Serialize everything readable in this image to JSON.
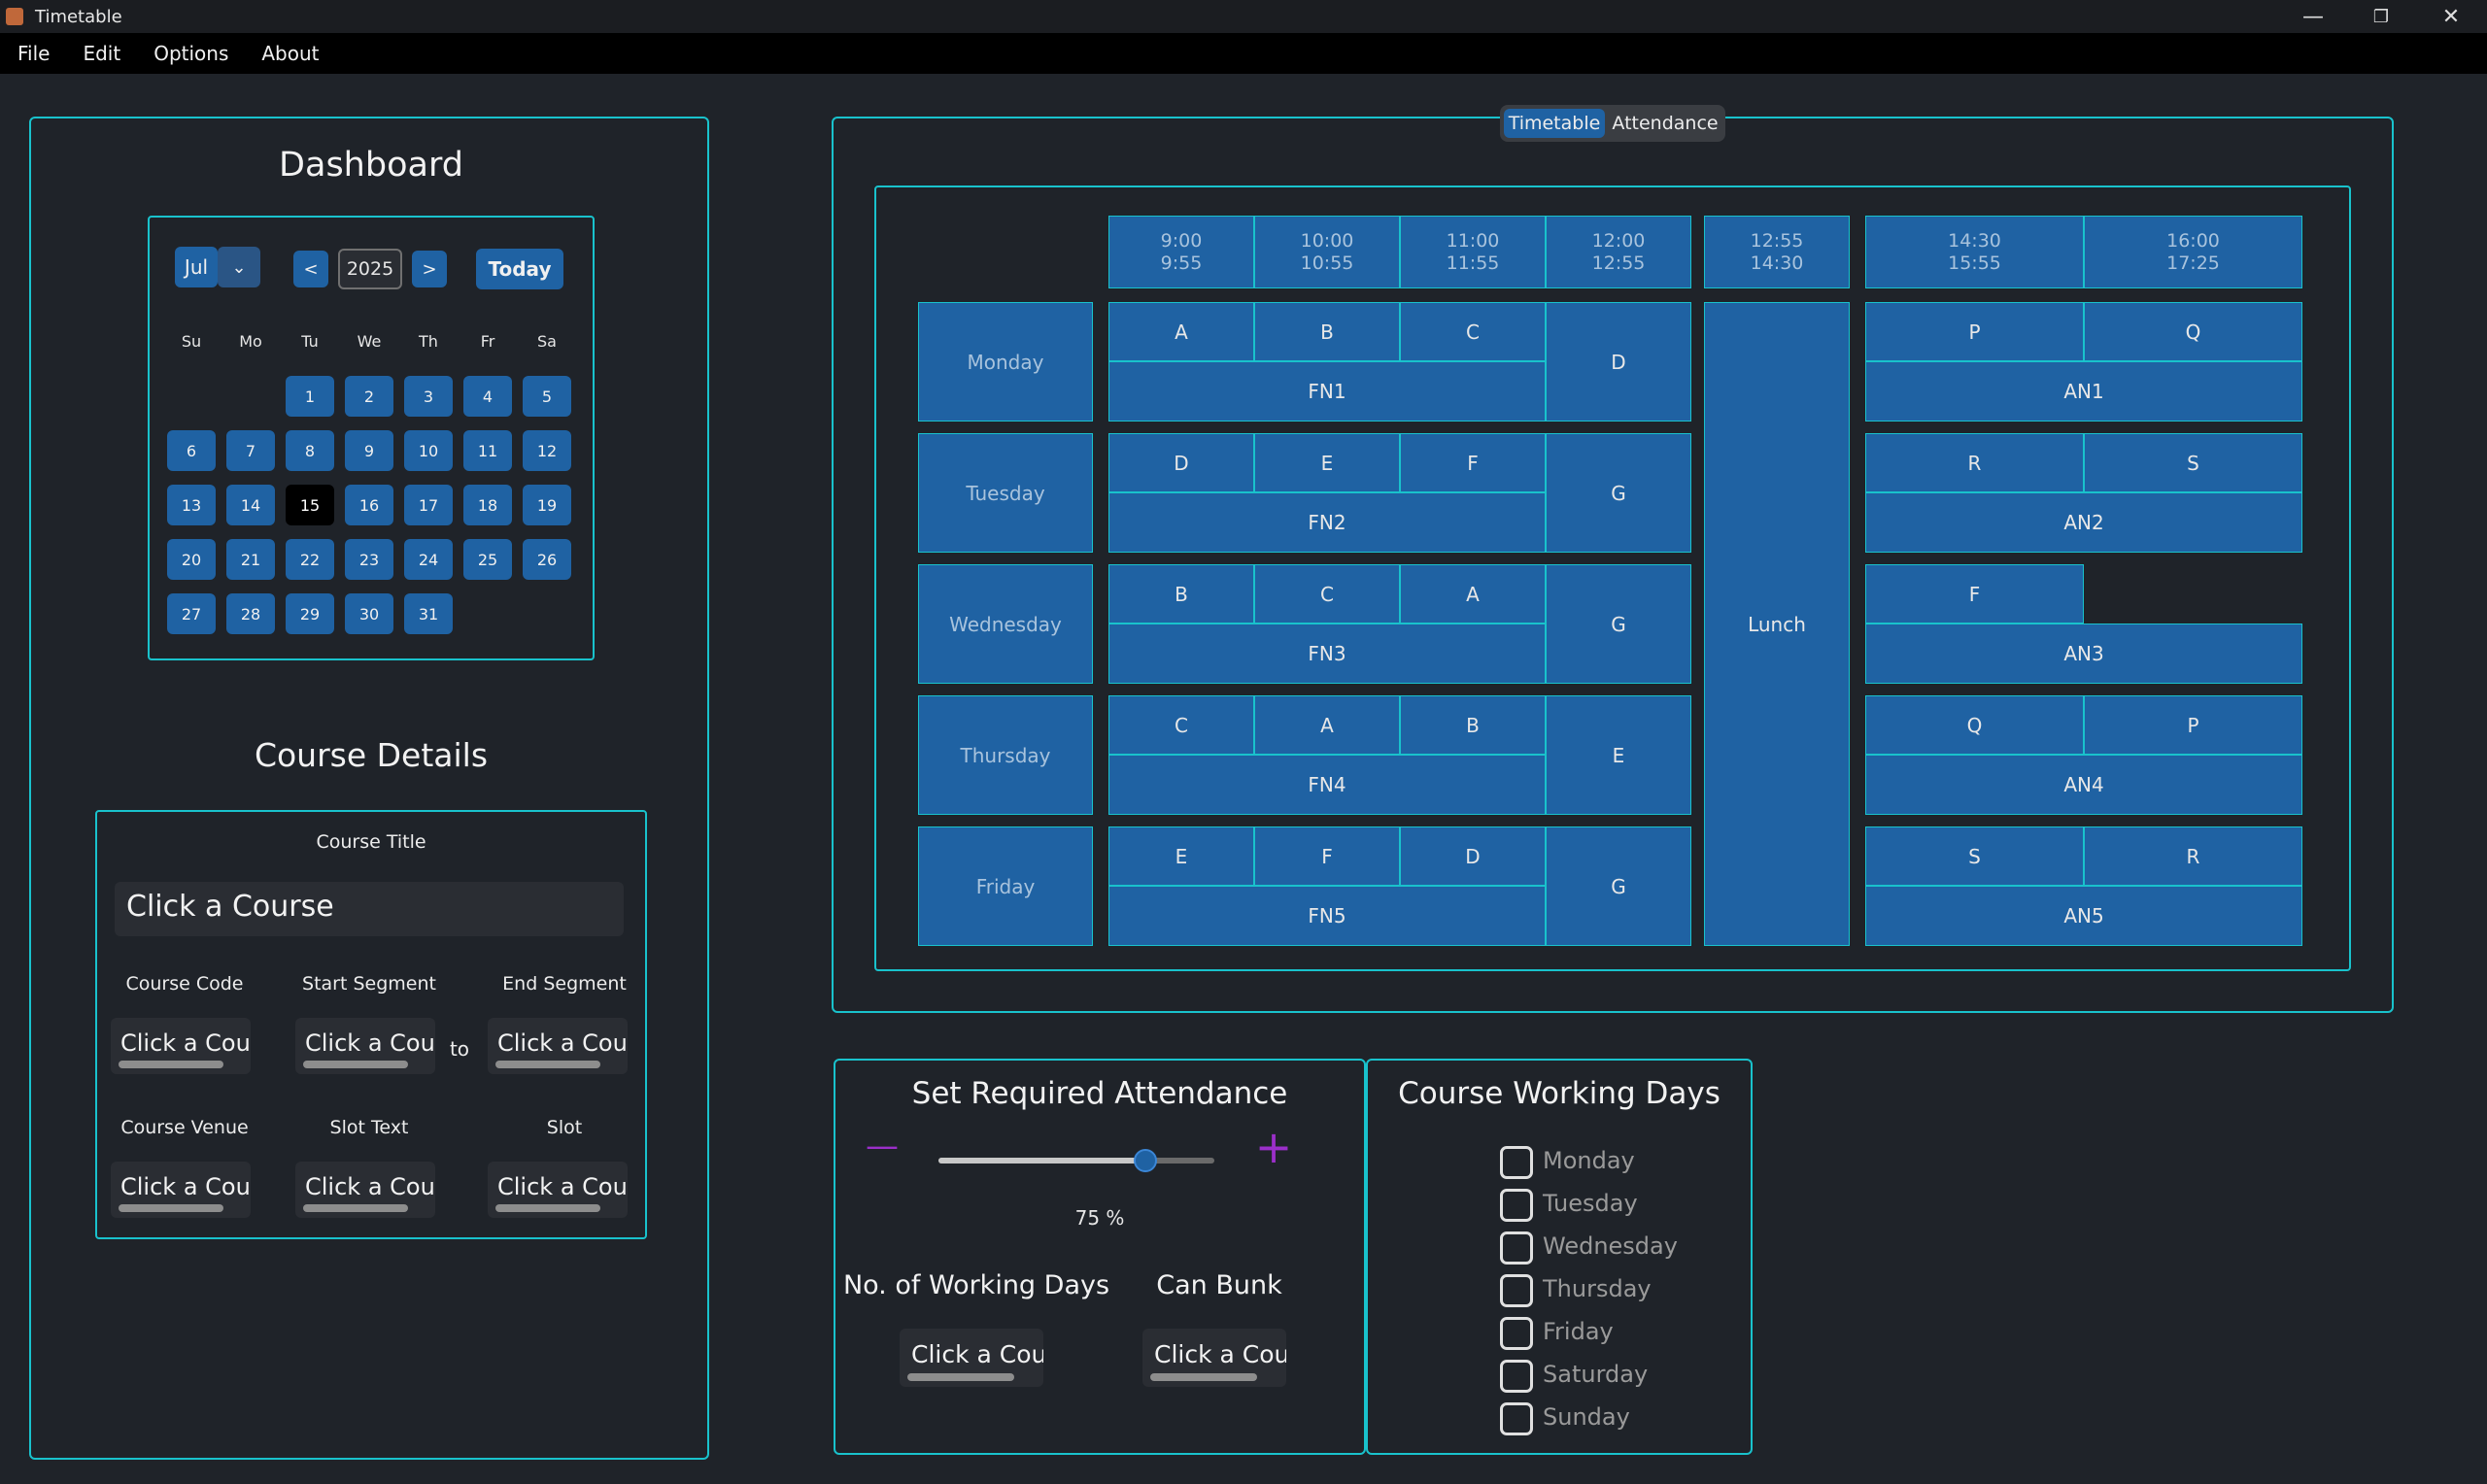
{
  "window": {
    "title": "Timetable",
    "minimize": "—",
    "restore": "❐",
    "close": "✕"
  },
  "menu": [
    "File",
    "Edit",
    "Options",
    "About"
  ],
  "dashboard": {
    "title": "Dashboard",
    "calendar": {
      "month": "Jul",
      "year": "2025",
      "prev": "<",
      "next": ">",
      "today_label": "Today",
      "weekdays": [
        "Su",
        "Mo",
        "Tu",
        "We",
        "Th",
        "Fr",
        "Sa"
      ],
      "today": "15",
      "days": [
        "1",
        "2",
        "3",
        "4",
        "5",
        "6",
        "7",
        "8",
        "9",
        "10",
        "11",
        "12",
        "13",
        "14",
        "15",
        "16",
        "17",
        "18",
        "19",
        "20",
        "21",
        "22",
        "23",
        "24",
        "25",
        "26",
        "27",
        "28",
        "29",
        "30",
        "31"
      ]
    }
  },
  "course_details": {
    "title": "Course Details",
    "course_title_label": "Course Title",
    "course_title_value": "Click a Course",
    "course_code_label": "Course Code",
    "start_segment_label": "Start Segment",
    "end_segment_label": "End Segment",
    "to_label": "to",
    "course_venue_label": "Course Venue",
    "slot_text_label": "Slot Text",
    "slot_label": "Slot",
    "field_value": "Click a Cour"
  },
  "timetable": {
    "tabs": [
      "Timetable",
      "Attendance"
    ],
    "active_tab": "Timetable",
    "times": [
      [
        "9:00",
        "9:55"
      ],
      [
        "10:00",
        "10:55"
      ],
      [
        "11:00",
        "11:55"
      ],
      [
        "12:00",
        "12:55"
      ],
      [
        "12:55",
        "14:30"
      ],
      [
        "14:30",
        "15:55"
      ],
      [
        "16:00",
        "17:25"
      ]
    ],
    "lunch": "Lunch",
    "days": [
      {
        "name": "Monday",
        "morning": [
          "A",
          "B",
          "C"
        ],
        "fn": "FN1",
        "noon": "D",
        "afternoon": [
          "P",
          "Q"
        ],
        "an": "AN1"
      },
      {
        "name": "Tuesday",
        "morning": [
          "D",
          "E",
          "F"
        ],
        "fn": "FN2",
        "noon": "G",
        "afternoon": [
          "R",
          "S"
        ],
        "an": "AN2"
      },
      {
        "name": "Wednesday",
        "morning": [
          "B",
          "C",
          "A"
        ],
        "fn": "FN3",
        "noon": "G",
        "afternoon": [
          "F"
        ],
        "an": "AN3"
      },
      {
        "name": "Thursday",
        "morning": [
          "C",
          "A",
          "B"
        ],
        "fn": "FN4",
        "noon": "E",
        "afternoon": [
          "Q",
          "P"
        ],
        "an": "AN4"
      },
      {
        "name": "Friday",
        "morning": [
          "E",
          "F",
          "D"
        ],
        "fn": "FN5",
        "noon": "G",
        "afternoon": [
          "S",
          "R"
        ],
        "an": "AN5"
      }
    ]
  },
  "attendance": {
    "title": "Set Required Attendance",
    "minus": "—",
    "plus": "+",
    "percent": 75,
    "percent_label": "75 %",
    "working_days_label": "No. of Working Days",
    "can_bunk_label": "Can Bunk",
    "field_value": "Click a Cour"
  },
  "working_days": {
    "title": "Course Working Days",
    "days": [
      "Monday",
      "Tuesday",
      "Wednesday",
      "Thursday",
      "Friday",
      "Saturday",
      "Sunday"
    ]
  },
  "colors": {
    "accent": "#19c2cc",
    "button": "#1f62a3",
    "background": "#1f2329",
    "plus_minus": "#9b2fc9",
    "slider": "#1f62a3"
  }
}
